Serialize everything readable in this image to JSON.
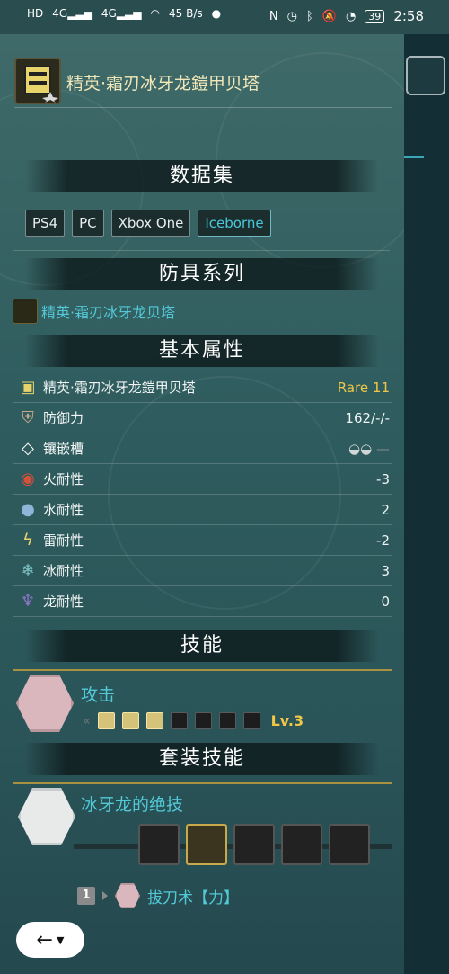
{
  "statusbar": {
    "left_icons": [
      "HD",
      "4G",
      "4G",
      "wifi-icon",
      "45 B/s",
      "wechat-icon"
    ],
    "net_speed": "45 B/s",
    "battery": "39",
    "time": "2:58"
  },
  "item": {
    "title": "精英·霜刃冰牙龙鎧甲贝塔"
  },
  "sections": {
    "dataset": "数据集",
    "armor_series": "防具系列",
    "base_attributes": "基本属性",
    "skills": "技能",
    "set_skills": "套装技能"
  },
  "platforms": [
    {
      "label": "PS4",
      "active": false
    },
    {
      "label": "PC",
      "active": false
    },
    {
      "label": "Xbox One",
      "active": false
    },
    {
      "label": "Iceborne",
      "active": true
    }
  ],
  "series": {
    "label": "精英·霜刃冰牙龙贝塔"
  },
  "attributes": [
    {
      "icon": "armor-chest-icon",
      "label": "精英·霜刃冰牙龙鎧甲贝塔",
      "value": "Rare 11",
      "highlight": true
    },
    {
      "icon": "shield-defense-icon",
      "label": "防御力",
      "value": "162/-/-",
      "highlight": false
    },
    {
      "icon": "gem-slot-icon",
      "label": "镶嵌槽",
      "value": "",
      "highlight": false
    },
    {
      "icon": "fire-icon",
      "label": "火耐性",
      "value": "-3",
      "highlight": false
    },
    {
      "icon": "water-drop-icon",
      "label": "水耐性",
      "value": "2",
      "highlight": false
    },
    {
      "icon": "thunder-icon",
      "label": "雷耐性",
      "value": "-2",
      "highlight": false
    },
    {
      "icon": "ice-icon",
      "label": "冰耐性",
      "value": "3",
      "highlight": false
    },
    {
      "icon": "dragon-icon",
      "label": "龙耐性",
      "value": "0",
      "highlight": false
    }
  ],
  "skill": {
    "name": "攻击",
    "level_filled": 3,
    "level_max": 7,
    "level_label": "Lv.3"
  },
  "set_skill": {
    "name": "冰牙龙的绝技",
    "pieces": [
      "helm",
      "chest",
      "arms",
      "waist",
      "legs"
    ],
    "active_piece": 1,
    "bonus_count": "1",
    "bonus_name": "拔刀术【力】"
  },
  "nav": {
    "back_icon": "←"
  }
}
